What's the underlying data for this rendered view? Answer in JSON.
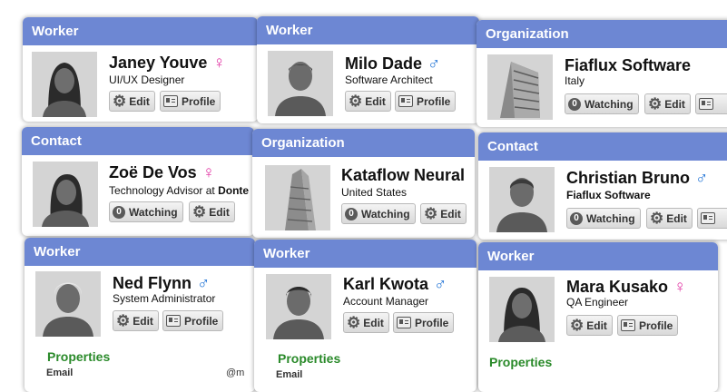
{
  "labels": {
    "edit": "Edit",
    "profile": "Profile",
    "watching": "Watching",
    "watching_count": "0",
    "properties": "Properties",
    "email": "Email",
    "email_partial": "@m"
  },
  "icons": [
    "gear-icon",
    "id-badge-icon",
    "female-icon",
    "male-icon"
  ],
  "colors": {
    "header": "#6d87d3",
    "female": "#e23ba6",
    "male": "#2274d6",
    "properties": "#2a8a2a"
  },
  "cards": {
    "c1": {
      "type": "Worker",
      "name": "Janey Youve",
      "subtitle": "UI/UX Designer",
      "gender": "♀"
    },
    "c2": {
      "type": "Worker",
      "name": "Milo Dade",
      "subtitle": "Software Architect",
      "gender": "♂"
    },
    "c3": {
      "type": "Organization",
      "name": "Fiaflux Software",
      "subtitle": "Italy"
    },
    "c4": {
      "type": "Contact",
      "name": "Zoë De Vos",
      "subtitle": "Technology Advisor at ",
      "company": "Donte",
      "gender": "♀"
    },
    "c5": {
      "type": "Organization",
      "name": "Kataflow Neural",
      "subtitle": "United States"
    },
    "c6": {
      "type": "Contact",
      "name": "Christian Bruno",
      "company": "Fiaflux Software",
      "gender": "♂"
    },
    "c7": {
      "type": "Worker",
      "name": "Ned Flynn",
      "subtitle": "System Administrator",
      "gender": "♂"
    },
    "c8": {
      "type": "Worker",
      "name": "Karl Kwota",
      "subtitle": "Account Manager",
      "gender": "♂"
    },
    "c9": {
      "type": "Worker",
      "name": "Mara Kusako",
      "subtitle": "QA Engineer",
      "gender": "♀"
    }
  }
}
